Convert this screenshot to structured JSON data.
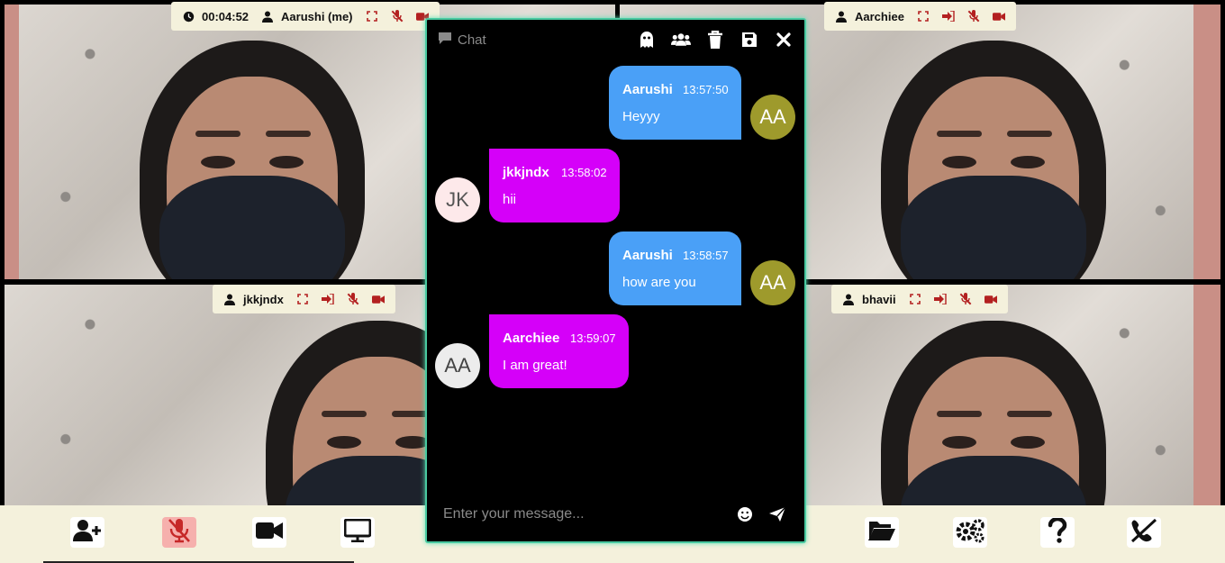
{
  "tiles": [
    {
      "name": "Aarushi (me)",
      "timer": "00:04:52"
    },
    {
      "name": "Aarchiee"
    },
    {
      "name": "jkkjndx"
    },
    {
      "name": "bhavii"
    }
  ],
  "chat": {
    "title": "Chat",
    "actions": [
      "ghost-icon",
      "users-icon",
      "trash-icon",
      "save-icon",
      "close-icon"
    ],
    "messages": [
      {
        "sender": "Aarushi",
        "time": "13:57:50",
        "text": "Heyyy",
        "initials": "AA",
        "direction": "out"
      },
      {
        "sender": "jkkjndx",
        "time": "13:58:02",
        "text": "hii",
        "initials": "JK",
        "direction": "in"
      },
      {
        "sender": "Aarushi",
        "time": "13:58:57",
        "text": "how are you",
        "initials": "AA",
        "direction": "out"
      },
      {
        "sender": "Aarchiee",
        "time": "13:59:07",
        "text": "I am great!",
        "initials": "AA",
        "direction": "in"
      }
    ],
    "placeholder": "Enter your message..."
  },
  "colors": {
    "outgoing_bubble": "#4aa0f7",
    "incoming_bubble": "#d500f9",
    "chat_border": "#48c9a0",
    "toolbar_bg": "#f4f1dc",
    "status_red": "#b32020"
  },
  "toolbar": [
    "add-user-icon",
    "mic-muted-icon",
    "video-camera-icon",
    "screen-share-icon",
    "folder-open-icon",
    "settings-icon",
    "help-icon",
    "hang-up-icon"
  ]
}
